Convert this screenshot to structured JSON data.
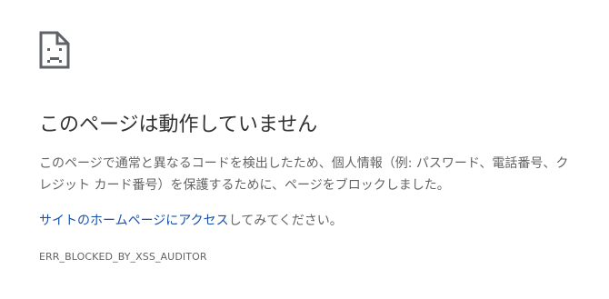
{
  "icon": {
    "name": "sad-page-icon"
  },
  "colors": {
    "title": "#333333",
    "text": "#646464",
    "link": "#1a52a8",
    "icon": "#5f6368"
  },
  "main": {
    "title": "このページは動作していません",
    "description": "このページで通常と異なるコードを検出したため、個人情報（例: パスワード、電話番号、クレジット カード番号）を保護するために、ページをブロックしました。",
    "suggestion_link": "サイトのホームページにアクセス",
    "suggestion_rest": "してみてください。",
    "error_code": "ERR_BLOCKED_BY_XSS_AUDITOR"
  }
}
